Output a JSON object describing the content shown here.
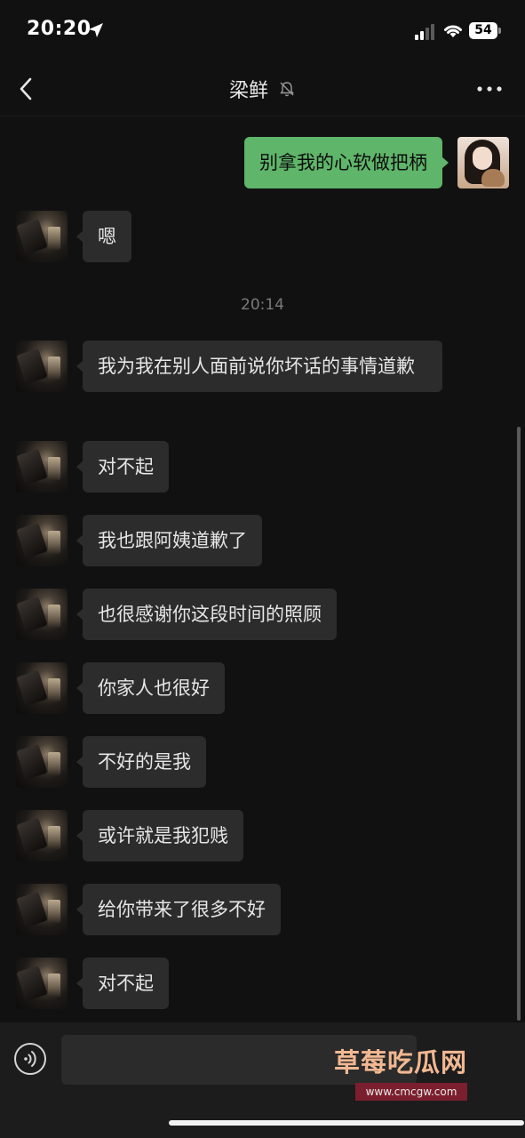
{
  "status_bar": {
    "time": "20:20",
    "location_icon": "location-arrow-icon",
    "signal_icon": "cellular-signal-icon",
    "wifi_icon": "wifi-icon",
    "battery_level": "54"
  },
  "header": {
    "back_icon": "chevron-left-icon",
    "title": "梁鲜",
    "mute_icon": "muted-bell-icon",
    "more_icon": "more-dots-icon"
  },
  "messages": [
    {
      "side": "right",
      "text": "别拿我的心软做把柄"
    },
    {
      "side": "left",
      "text": "嗯"
    },
    {
      "type": "time",
      "text": "20:14"
    },
    {
      "side": "left",
      "text": "我为我在别人面前说你坏话的事情道歉"
    },
    {
      "side": "left",
      "text": "对不起"
    },
    {
      "side": "left",
      "text": "我也跟阿姨道歉了"
    },
    {
      "side": "left",
      "text": "也很感谢你这段时间的照顾"
    },
    {
      "side": "left",
      "text": "你家人也很好"
    },
    {
      "side": "left",
      "text": "不好的是我"
    },
    {
      "side": "left",
      "text": "或许就是我犯贱"
    },
    {
      "side": "left",
      "text": "给你带来了很多不好"
    },
    {
      "side": "left",
      "text": "对不起"
    }
  ],
  "input_bar": {
    "voice_icon": "voice-input-icon",
    "input_value": ""
  },
  "watermark": {
    "text": "草莓吃瓜网",
    "url": "www.cmcgw.com"
  },
  "colors": {
    "background": "#111111",
    "incoming_bubble": "#2c2c2c",
    "outgoing_bubble": "#5fb569",
    "watermark": "#f1b892"
  }
}
